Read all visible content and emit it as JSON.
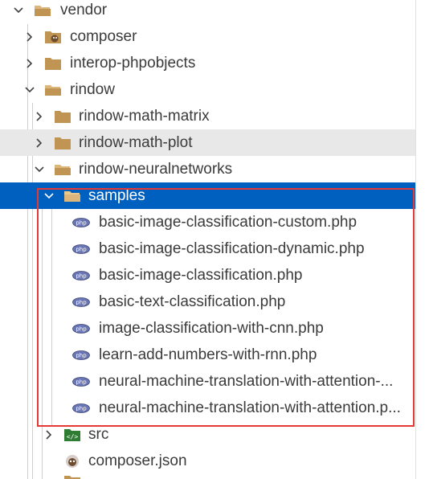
{
  "tree": {
    "vendor": "vendor",
    "composer": "composer",
    "interop": "interop-phpobjects",
    "rindow": "rindow",
    "math_matrix": "rindow-math-matrix",
    "math_plot": "rindow-math-plot",
    "neuralnetworks": "rindow-neuralnetworks",
    "samples": "samples",
    "files": [
      "basic-image-classification-custom.php",
      "basic-image-classification-dynamic.php",
      "basic-image-classification.php",
      "basic-text-classification.php",
      "image-classification-with-cnn.php",
      "learn-add-numbers-with-rnn.php",
      "neural-machine-translation-with-attention-...",
      "neural-machine-translation-with-attention.p..."
    ],
    "src": "src",
    "composer_json": "composer.json"
  },
  "icons": {
    "folder": "folder-icon",
    "open_folder": "folder-open-icon",
    "php": "php-file-icon",
    "src": "src-folder-icon",
    "composer_pkg": "composer-icon",
    "json": "composer-json-icon"
  },
  "colors": {
    "selection": "#0060c0",
    "hover": "#e8e8e8",
    "folder": "#c09553",
    "highlight_box": "#e53935"
  }
}
